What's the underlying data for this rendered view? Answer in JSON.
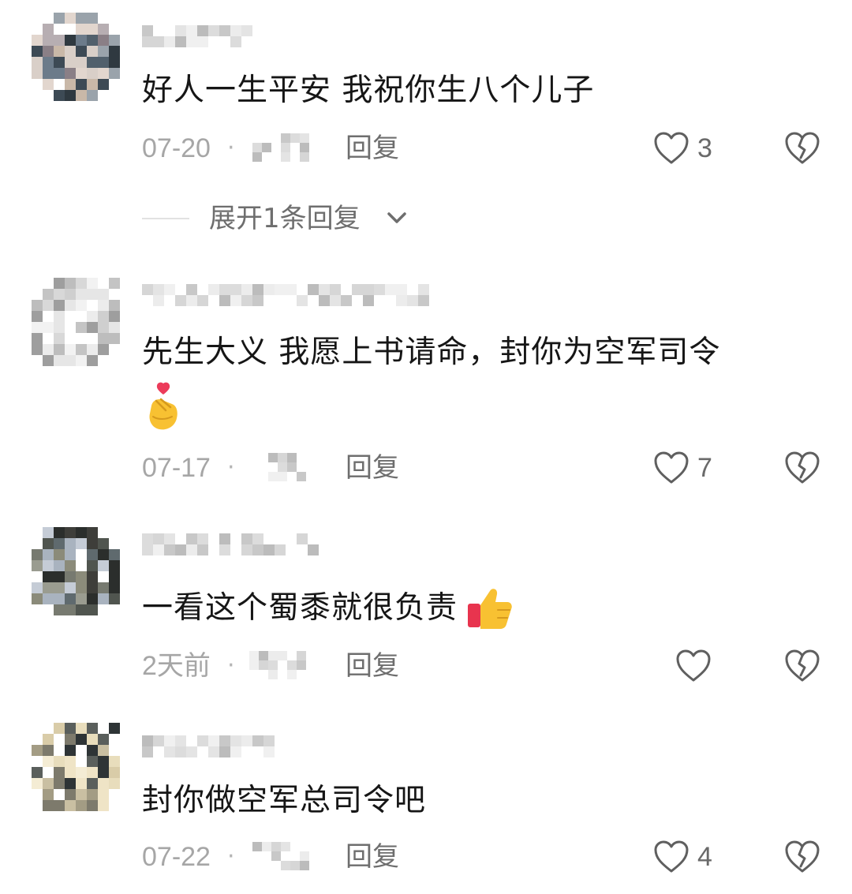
{
  "comments": [
    {
      "text": "好人一生平安 我祝你生八个儿子",
      "date": "07-20",
      "separator": "·",
      "reply_label": "回复",
      "like_count": "3"
    },
    {
      "text": "先生大义 我愿上书请命，封你为空军司令",
      "trailing_emoji": "finger-heart",
      "date": "07-17",
      "separator": "·",
      "reply_label": "回复",
      "like_count": "7"
    },
    {
      "text": "一看这个蜀黍就很负责",
      "trailing_emoji": "thumbs-up",
      "date": "2天前",
      "separator": "·",
      "reply_label": "回复",
      "like_count": ""
    },
    {
      "text": "封你做空军总司令吧",
      "date": "07-22",
      "separator": "·",
      "reply_label": "回复",
      "like_count": "4"
    }
  ],
  "expand_replies": {
    "label": "展开1条回复"
  },
  "icons": {
    "like": "heart-outline-icon",
    "dislike": "broken-heart-icon",
    "expand": "chevron-down-icon"
  },
  "colors": {
    "text": "#161616",
    "meta": "#a6a6a6",
    "action": "#6e6e6e",
    "icon": "#5f5f5f",
    "emoji_yellow": "#f8c132",
    "emoji_heart": "#ec3b5a"
  }
}
